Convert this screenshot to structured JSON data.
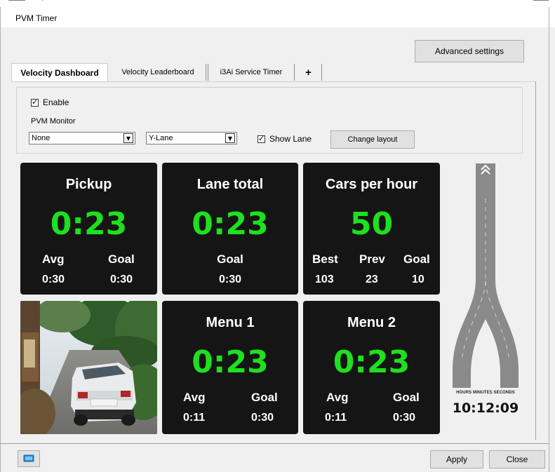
{
  "window": {
    "title": "PVM Timer"
  },
  "toolbar": {
    "advanced_settings": "Advanced settings"
  },
  "tabs": [
    {
      "label": "Velocity Dashboard",
      "active": true
    },
    {
      "label": "Velocity Leaderboard",
      "active": false
    },
    {
      "label": "i3Ai Service Timer",
      "active": false
    },
    {
      "label": "+",
      "active": false
    }
  ],
  "settings": {
    "enable_label": "Enable",
    "enable_checked": true,
    "monitor_label": "PVM Monitor",
    "monitor_value": "None",
    "lane_value": "Y-Lane",
    "show_lane_label": "Show Lane",
    "show_lane_checked": true,
    "change_layout": "Change layout"
  },
  "tiles": {
    "pickup": {
      "title": "Pickup",
      "time": "0:23",
      "avg_label": "Avg",
      "avg": "0:30",
      "goal_label": "Goal",
      "goal": "0:30"
    },
    "lane_total": {
      "title": "Lane total",
      "time": "0:23",
      "goal_label": "Goal",
      "goal": "0:30"
    },
    "cars_per_hour": {
      "title": "Cars per hour",
      "value": "50",
      "best_label": "Best",
      "best": "103",
      "prev_label": "Prev",
      "prev": "23",
      "goal_label": "Goal",
      "goal": "10"
    },
    "menu1": {
      "title": "Menu 1",
      "time": "0:23",
      "avg_label": "Avg",
      "avg": "0:11",
      "goal_label": "Goal",
      "goal": "0:30"
    },
    "menu2": {
      "title": "Menu 2",
      "time": "0:23",
      "avg_label": "Avg",
      "avg": "0:11",
      "goal_label": "Goal",
      "goal": "0:30"
    }
  },
  "clock": {
    "caption": "HOURS MINUTES SECONDS",
    "value": "10:12:09"
  },
  "icons": {
    "monitor": "monitor-icon",
    "lane": "y-lane-road-icon",
    "direction": "double-chevron-up-icon"
  },
  "colors": {
    "timer_green": "#1ee01e",
    "tile_bg": "#151515",
    "road": "#8a8a8a"
  },
  "footer": {
    "apply": "Apply",
    "close": "Close"
  }
}
